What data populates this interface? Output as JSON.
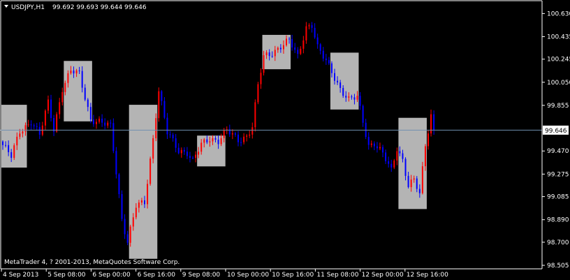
{
  "chart_data": {
    "type": "candlestick",
    "header": {
      "symbol_timeframe": "USDJPY,H1",
      "ohlc": "99.692 99.693 99.644 99.646"
    },
    "current_price": 99.646,
    "current_price_label": "99.646",
    "ylim": [
      98.505,
      100.65
    ],
    "y_ticks": [
      "100.630",
      "100.435",
      "100.245",
      "100.050",
      "99.855",
      "99.646",
      "99.470",
      "99.275",
      "99.085",
      "98.890",
      "98.700",
      "98.505"
    ],
    "x_ticks": [
      "4 Sep 2013",
      "5 Sep 08:00",
      "6 Sep 00:00",
      "6 Sep 16:00",
      "9 Sep 08:00",
      "10 Sep 00:00",
      "10 Sep 16:00",
      "11 Sep 08:00",
      "12 Sep 00:00",
      "12 Sep 16:00"
    ],
    "bar_count": 153,
    "anchors": [
      [
        0,
        99.52
      ],
      [
        3,
        99.42
      ],
      [
        6,
        99.64
      ],
      [
        10,
        99.72
      ],
      [
        13,
        99.6
      ],
      [
        16,
        99.88
      ],
      [
        18,
        99.66
      ],
      [
        21,
        100.0
      ],
      [
        24,
        100.14
      ],
      [
        27,
        100.12
      ],
      [
        31,
        99.74
      ],
      [
        35,
        99.7
      ],
      [
        38,
        99.68
      ],
      [
        40,
        99.3
      ],
      [
        42,
        98.9
      ],
      [
        44,
        98.7
      ],
      [
        47,
        99.0
      ],
      [
        50,
        99.04
      ],
      [
        53,
        99.58
      ],
      [
        55,
        99.98
      ],
      [
        58,
        99.62
      ],
      [
        62,
        99.48
      ],
      [
        65,
        99.46
      ],
      [
        67,
        99.38
      ],
      [
        70,
        99.52
      ],
      [
        73,
        99.58
      ],
      [
        76,
        99.56
      ],
      [
        79,
        99.64
      ],
      [
        83,
        99.56
      ],
      [
        86,
        99.6
      ],
      [
        88,
        99.68
      ],
      [
        90,
        100.02
      ],
      [
        92,
        100.26
      ],
      [
        95,
        100.3
      ],
      [
        98,
        100.36
      ],
      [
        101,
        100.4
      ],
      [
        104,
        100.26
      ],
      [
        107,
        100.52
      ],
      [
        109,
        100.54
      ],
      [
        111,
        100.34
      ],
      [
        113,
        100.26
      ],
      [
        116,
        100.14
      ],
      [
        119,
        100.0
      ],
      [
        122,
        99.9
      ],
      [
        125,
        99.92
      ],
      [
        127,
        99.72
      ],
      [
        129,
        99.52
      ],
      [
        131,
        99.54
      ],
      [
        134,
        99.44
      ],
      [
        137,
        99.3
      ],
      [
        139,
        99.5
      ],
      [
        141,
        99.4
      ],
      [
        143,
        99.18
      ],
      [
        145,
        99.22
      ],
      [
        147,
        99.1
      ],
      [
        149,
        99.52
      ],
      [
        151,
        99.78
      ],
      [
        152,
        99.65
      ]
    ],
    "highlight_ranges_bars": [
      [
        0,
        8
      ],
      [
        22,
        31
      ],
      [
        45,
        54
      ],
      [
        69,
        78
      ],
      [
        92,
        101
      ],
      [
        116,
        125
      ],
      [
        140,
        149
      ]
    ],
    "highlight_ranges_price": [
      [
        99.33,
        99.86
      ],
      [
        99.72,
        100.23
      ],
      [
        98.56,
        99.86
      ],
      [
        99.34,
        99.6
      ],
      [
        100.16,
        100.45
      ],
      [
        99.82,
        100.3
      ],
      [
        98.98,
        99.75
      ]
    ],
    "colors": {
      "background": "#000000",
      "bull": "#ff0000",
      "bear": "#0000ff",
      "highlight": "#b4b4b4",
      "price_line": "#6f8faf",
      "axis": "#ffffff"
    }
  },
  "footer": {
    "copyright": "MetaTrader 4, ? 2001-2013, MetaQuotes Software Corp."
  }
}
